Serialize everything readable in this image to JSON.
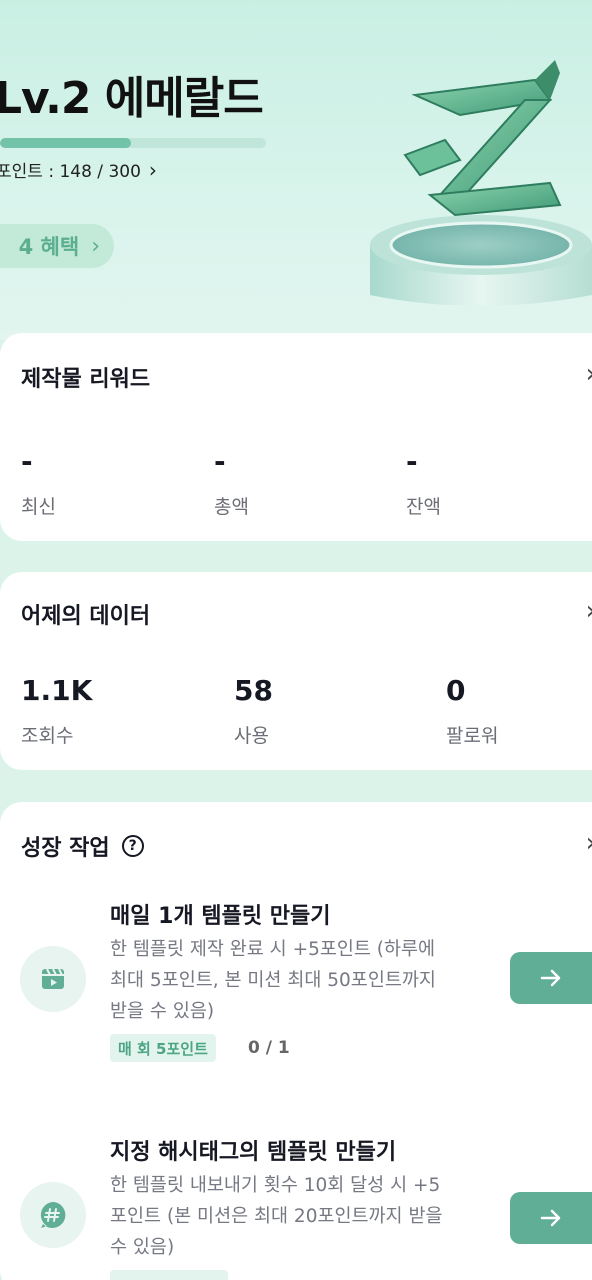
{
  "header": {
    "level_title": "Lv.2 에메랄드",
    "progress_fraction": 0.4933,
    "points_text": "포인트 : 148 / 300",
    "benefit_label": "4 혜택"
  },
  "reward_card": {
    "title": "제작물 리워드",
    "stats": [
      {
        "value": "-",
        "label": "최신"
      },
      {
        "value": "-",
        "label": "총액"
      },
      {
        "value": "-",
        "label": "잔액"
      }
    ]
  },
  "yesterday_card": {
    "title": "어제의 데이터",
    "stats": [
      {
        "value": "1.1K",
        "label": "조회수"
      },
      {
        "value": "58",
        "label": "사용"
      },
      {
        "value": "0",
        "label": "팔로워"
      }
    ]
  },
  "growth_card": {
    "title": "성장 작업",
    "tasks": [
      {
        "icon": "clapperboard-icon",
        "name": "매일 1개 템플릿 만들기",
        "desc_lines": [
          "한 템플릿 제작 완료 시 +5포인트 (하루에",
          "최대 5포인트, 본 미션 최대 50포인트까지",
          "받을 수 있음)"
        ],
        "tag": "매 회 5포인트",
        "progress": "0 / 1"
      },
      {
        "icon": "hashtag-icon",
        "name": "지정 해시태그의 템플릿 만들기",
        "desc_lines": [
          "한 템플릿 내보내기 횟수 10회 달성 시 +5",
          "포인트 (본 미션은 최대 20포인트까지 받을",
          "수 있음)"
        ]
      }
    ]
  },
  "colors": {
    "background": "#dcf3ea",
    "accent": "#5fae95",
    "progress_fill": "#73c3a8",
    "tag_bg": "#e2f4ed"
  }
}
